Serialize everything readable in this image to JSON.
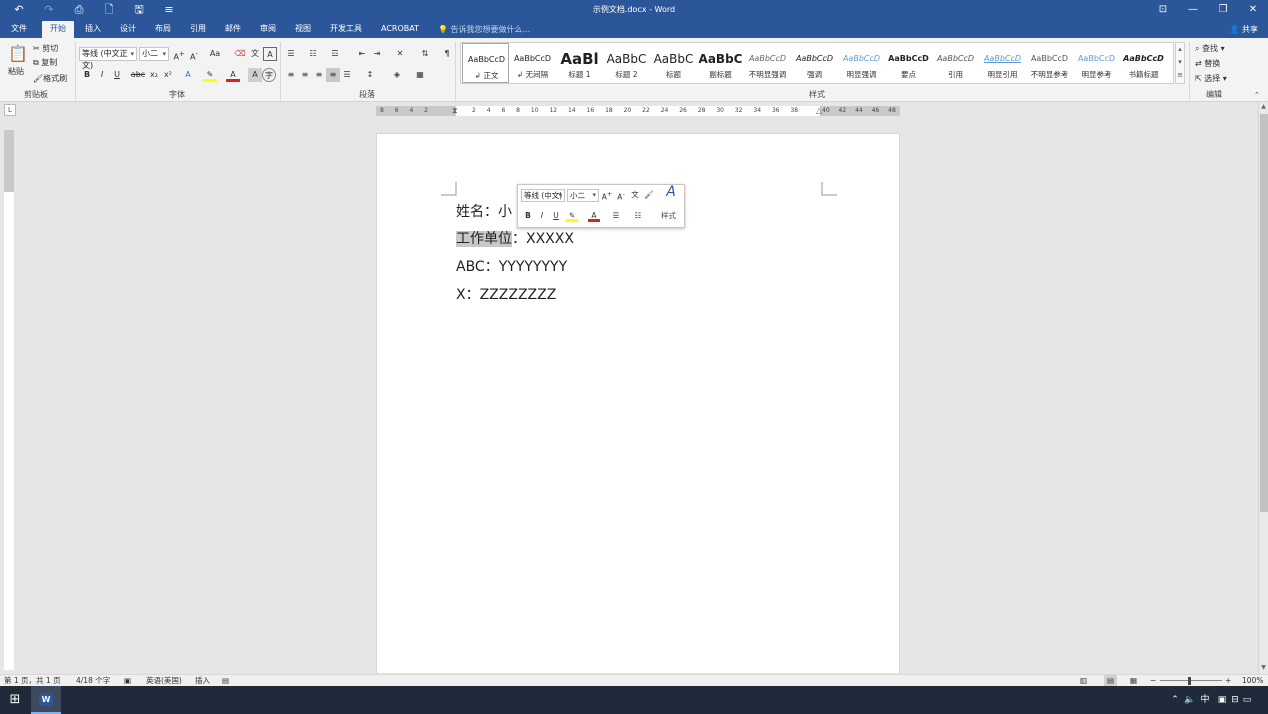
{
  "app": {
    "title": "示例文档.docx - Word",
    "window_controls": [
      "⊡",
      "—",
      "❐",
      "✕"
    ]
  },
  "quick_access": {
    "undo": "↶",
    "redo": "↷",
    "preview": "⎙",
    "new": "🗋",
    "save": "🖫",
    "customize": "≡"
  },
  "tabs": [
    {
      "label": "文件"
    },
    {
      "label": "开始",
      "active": true
    },
    {
      "label": "插入"
    },
    {
      "label": "设计"
    },
    {
      "label": "布局"
    },
    {
      "label": "引用"
    },
    {
      "label": "邮件"
    },
    {
      "label": "审阅"
    },
    {
      "label": "视图"
    },
    {
      "label": "开发工具"
    },
    {
      "label": "ACROBAT"
    }
  ],
  "tell_me": "告诉我您想要做什么...",
  "share": "共享",
  "ribbon": {
    "clipboard": {
      "paste": "粘贴",
      "cut": "剪切",
      "copy": "复制",
      "format_painter": "格式刷",
      "label": "剪贴板"
    },
    "font": {
      "font_name": "等线 (中文正文)",
      "font_size": "小二",
      "change_case": "Aa",
      "bold": "B",
      "italic": "I",
      "underline": "U",
      "strikethrough": "abc",
      "subscript": "x₂",
      "superscript": "x²",
      "label": "字体"
    },
    "paragraph": {
      "label": "段落"
    },
    "styles": {
      "label": "样式",
      "items": [
        {
          "preview": "AaBbCcD",
          "name": "↲ 正文",
          "selected": true
        },
        {
          "preview": "AaBbCcD",
          "name": "↲ 无间隔"
        },
        {
          "preview": "AaBl",
          "name": "标题 1"
        },
        {
          "preview": "AaBbC",
          "name": "标题 2"
        },
        {
          "preview": "AaBbC",
          "name": "标题"
        },
        {
          "preview": "AaBbC",
          "name": "副标题"
        },
        {
          "preview": "AaBbCcD",
          "name": "不明显强调"
        },
        {
          "preview": "AaBbCcD",
          "name": "强调"
        },
        {
          "preview": "AaBbCcD",
          "name": "明显强调"
        },
        {
          "preview": "AaBbCcD",
          "name": "要点"
        },
        {
          "preview": "AaBbCcD",
          "name": "引用"
        },
        {
          "preview": "AaBbCcD",
          "name": "明显引用"
        },
        {
          "preview": "AaBbCcD",
          "name": "不明显参考"
        },
        {
          "preview": "AaBbCcD",
          "name": "明显参考"
        },
        {
          "preview": "AaBbCcD",
          "name": "书籍标题"
        }
      ]
    },
    "editing": {
      "find": "查找",
      "replace": "替换",
      "select": "选择",
      "label": "编辑"
    }
  },
  "ruler": {
    "left_numbers": "8 6 4 2",
    "numbers": "2 4 6 8 10 12 14 16 18 20 22 24 26 28 30 32 34 36 38",
    "right_numbers": "40 42 44 46 48"
  },
  "document": {
    "lines": [
      {
        "text": "姓名：小"
      },
      {
        "highlight": "工作单位",
        "rest": "：XXXXX"
      },
      {
        "text": "ABC：YYYYYYYY"
      },
      {
        "text": "X：ZZZZZZZZ"
      }
    ]
  },
  "mini_toolbar": {
    "font_name": "等线 (中文)",
    "font_size": "小二",
    "styles_label": "样式"
  },
  "status": {
    "page": "第 1 页，共 1 页",
    "words": "4/18 个字",
    "language": "英语(美国)",
    "mode": "插入",
    "zoom": "100%"
  },
  "colors": {
    "accent": "#2b579a",
    "font_color": "#e02020",
    "highlight": "#ffff00"
  }
}
